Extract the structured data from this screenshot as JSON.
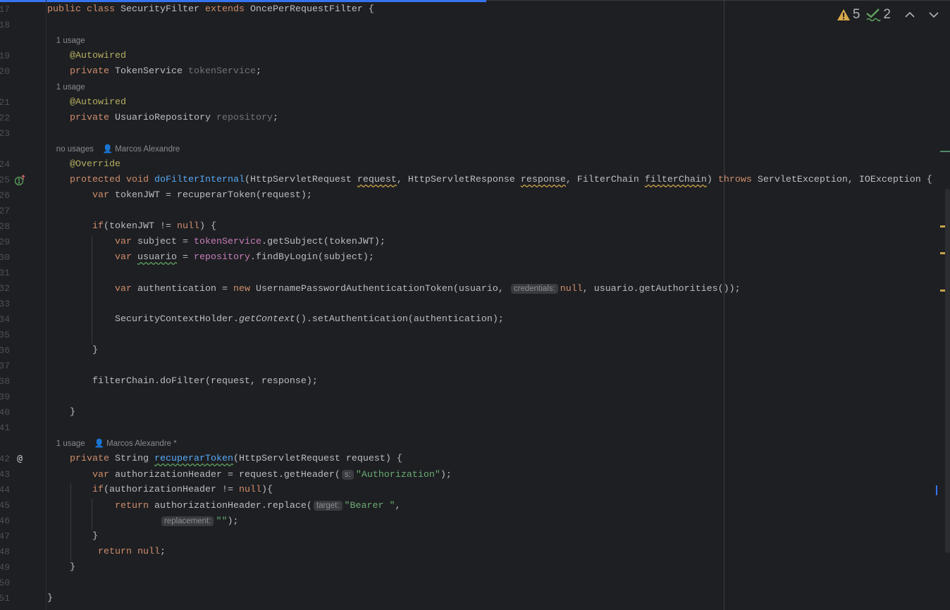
{
  "status": {
    "warnings": "5",
    "weak_warnings": "2",
    "warning_icon": "warning-triangle-icon",
    "weak_icon": "check-wavy-icon",
    "prev_icon": "chevron-up-icon",
    "next_icon": "chevron-down-icon"
  },
  "colors": {
    "background": "#1e1f22",
    "keyword": "#cf8e6d",
    "method": "#56a8f5",
    "annotation": "#b3ae60",
    "field": "#c77dbb",
    "string": "#6aab73",
    "accent": "#3574f0"
  },
  "rows": [
    {
      "n": "17",
      "t": [
        [
          "public class ",
          "kw"
        ],
        [
          "SecurityFilter ",
          ""
        ],
        [
          "extends ",
          "kw"
        ],
        [
          "OncePerRequestFilter {",
          ""
        ]
      ]
    },
    {
      "n": "18",
      "t": []
    },
    {
      "inlay": "    1 usage"
    },
    {
      "n": "19",
      "t": [
        [
          "    @Autowired",
          "ann"
        ]
      ]
    },
    {
      "n": "20",
      "t": [
        [
          "    private ",
          "kw"
        ],
        [
          "TokenService ",
          ""
        ],
        [
          "tokenService",
          "dim"
        ],
        [
          ";",
          ""
        ]
      ]
    },
    {
      "inlay": "    1 usage"
    },
    {
      "n": "21",
      "t": [
        [
          "    @Autowired",
          "ann"
        ]
      ]
    },
    {
      "n": "22",
      "t": [
        [
          "    private ",
          "kw"
        ],
        [
          "UsuarioRepository ",
          ""
        ],
        [
          "repository",
          "dim"
        ],
        [
          ";",
          ""
        ]
      ]
    },
    {
      "n": "23",
      "t": []
    },
    {
      "inlay": "    no usages    👤 Marcos Alexandre"
    },
    {
      "n": "24",
      "t": [
        [
          "    @Override",
          "ann"
        ]
      ]
    },
    {
      "n": "25",
      "icon": "implements-icon",
      "t": [
        [
          "    protected void ",
          "kw"
        ],
        [
          "doFilterInternal",
          "fn"
        ],
        [
          "(HttpServletRequest ",
          ""
        ],
        [
          "request",
          "warn"
        ],
        [
          ", HttpServletResponse ",
          ""
        ],
        [
          "response",
          "warn"
        ],
        [
          ", FilterChain ",
          ""
        ],
        [
          "filterChain",
          "warn"
        ],
        [
          ") ",
          ""
        ],
        [
          "throws ",
          "kw"
        ],
        [
          "ServletException, IOException {",
          ""
        ]
      ]
    },
    {
      "n": "26",
      "t": [
        [
          "        var ",
          "kw"
        ],
        [
          "tokenJWT = recuperarToken(request);",
          ""
        ]
      ]
    },
    {
      "n": "27",
      "t": []
    },
    {
      "n": "28",
      "t": [
        [
          "        if",
          "kw"
        ],
        [
          "(tokenJWT != ",
          ""
        ],
        [
          "null",
          "kw"
        ],
        [
          ") {",
          ""
        ]
      ]
    },
    {
      "n": "29",
      "t": [
        [
          "            var ",
          "kw"
        ],
        [
          "subject = ",
          ""
        ],
        [
          "tokenService",
          "fld"
        ],
        [
          ".getSubject(tokenJWT);",
          ""
        ]
      ]
    },
    {
      "n": "30",
      "t": [
        [
          "            var ",
          "kw"
        ],
        [
          "usuario",
          "weak"
        ],
        [
          " = ",
          ""
        ],
        [
          "repository",
          "fld"
        ],
        [
          ".findByLogin(subject);",
          ""
        ]
      ]
    },
    {
      "n": "31",
      "t": []
    },
    {
      "n": "32",
      "t": [
        [
          "            var ",
          "kw"
        ],
        [
          "authentication = ",
          ""
        ],
        [
          "new ",
          "kw"
        ],
        [
          "UsernamePasswordAuthenticationToken(usuario, ",
          ""
        ],
        [
          "credentials:",
          "hint"
        ],
        [
          "null",
          "kw"
        ],
        [
          ", usuario.getAuthorities());",
          ""
        ]
      ]
    },
    {
      "n": "33",
      "t": []
    },
    {
      "n": "34",
      "t": [
        [
          "            SecurityContextHolder.",
          ""
        ],
        [
          "getContext",
          "it"
        ],
        [
          "().setAuthentication(authentication);",
          ""
        ]
      ]
    },
    {
      "n": "35",
      "t": []
    },
    {
      "n": "36",
      "t": [
        [
          "        }",
          ""
        ]
      ]
    },
    {
      "n": "37",
      "t": []
    },
    {
      "n": "38",
      "t": [
        [
          "        filterChain.doFilter(request, response);",
          ""
        ]
      ]
    },
    {
      "n": "39",
      "t": []
    },
    {
      "n": "40",
      "t": [
        [
          "    }",
          ""
        ]
      ]
    },
    {
      "n": "41",
      "t": []
    },
    {
      "inlay": "    1 usage    👤 Marcos Alexandre *"
    },
    {
      "n": "42",
      "icon": "at-icon",
      "t": [
        [
          "    private ",
          "kw"
        ],
        [
          "String ",
          ""
        ],
        [
          "recuperarToken",
          "fn weak"
        ],
        [
          "(HttpServletRequest request) {",
          ""
        ]
      ]
    },
    {
      "n": "43",
      "t": [
        [
          "        var ",
          "kw"
        ],
        [
          "authorizationHeader = request.getHeader(",
          ""
        ],
        [
          "s:",
          "hint"
        ],
        [
          "\"Authorization\"",
          "str"
        ],
        [
          ");",
          ""
        ]
      ]
    },
    {
      "n": "44",
      "t": [
        [
          "        if",
          "kw"
        ],
        [
          "(authorizationHeader != ",
          ""
        ],
        [
          "null",
          "kw"
        ],
        [
          "){",
          ""
        ]
      ]
    },
    {
      "n": "45",
      "t": [
        [
          "            return ",
          "kw"
        ],
        [
          "authorizationHeader.replace(",
          ""
        ],
        [
          "target:",
          "hint"
        ],
        [
          "\"Bearer \"",
          "str"
        ],
        [
          ",",
          ""
        ]
      ]
    },
    {
      "n": "46",
      "t": [
        [
          "                    ",
          ""
        ],
        [
          "replacement:",
          "hint"
        ],
        [
          "\"\"",
          "str"
        ],
        [
          ");",
          ""
        ]
      ]
    },
    {
      "n": "47",
      "t": [
        [
          "        }",
          ""
        ]
      ]
    },
    {
      "n": "48",
      "t": [
        [
          "         return ",
          "kw"
        ],
        [
          "null",
          "kw"
        ],
        [
          ";",
          ""
        ]
      ]
    },
    {
      "n": "49",
      "t": [
        [
          "    }",
          ""
        ]
      ]
    },
    {
      "n": "50",
      "t": []
    },
    {
      "n": "51",
      "t": [
        [
          "}",
          ""
        ]
      ]
    }
  ]
}
